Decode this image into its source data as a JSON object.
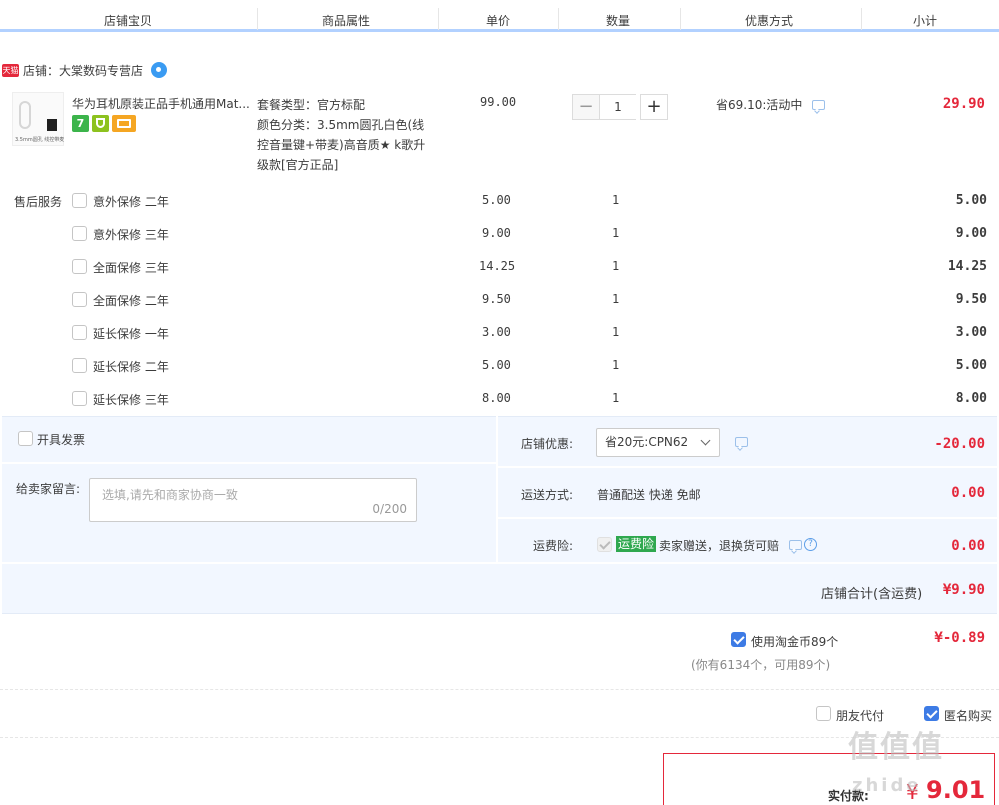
{
  "header": {
    "cols": [
      "店铺宝贝",
      "商品属性",
      "单价",
      "数量",
      "优惠方式",
      "小计"
    ]
  },
  "shop": {
    "badge": "天猫",
    "name": "店铺：大棠数码专营店"
  },
  "item": {
    "thumb_label": "3.5mm圆孔 线控带麦",
    "title": "华为耳机原装正品手机通用Mat...",
    "attr_lines": [
      "套餐类型：官方标配",
      "颜色分类：3.5mm圆孔白色(线",
      "控音量键+带麦)高音质★ k歌升",
      "级款[官方正品]"
    ],
    "price": "99.00",
    "quantity": "1",
    "qty_minus": "−",
    "qty_plus": "+",
    "promo": "省69.10:活动中",
    "subtotal": "29.90",
    "tag7": "7"
  },
  "services": {
    "label": "售后服务",
    "rows": [
      {
        "name": "意外保修 二年",
        "price": "5.00",
        "qty": "1",
        "sub": "5.00"
      },
      {
        "name": "意外保修 三年",
        "price": "9.00",
        "qty": "1",
        "sub": "9.00"
      },
      {
        "name": "全面保修 三年",
        "price": "14.25",
        "qty": "1",
        "sub": "14.25"
      },
      {
        "name": "全面保修 二年",
        "price": "9.50",
        "qty": "1",
        "sub": "9.50"
      },
      {
        "name": "延长保修 一年",
        "price": "3.00",
        "qty": "1",
        "sub": "3.00"
      },
      {
        "name": "延长保修 二年",
        "price": "5.00",
        "qty": "1",
        "sub": "5.00"
      },
      {
        "name": "延长保修 三年",
        "price": "8.00",
        "qty": "1",
        "sub": "8.00"
      }
    ]
  },
  "invoice": {
    "label": "开具发票"
  },
  "message": {
    "label": "给卖家留言:",
    "placeholder": "选填,请先和商家协商一致",
    "count": "0/200"
  },
  "discount": {
    "label": "店铺优惠:",
    "selected": "省20元:CPN62",
    "amount": "-20.00"
  },
  "shipping": {
    "label": "运送方式:",
    "value": "普通配送 快递 免邮",
    "amount": "0.00"
  },
  "insurance": {
    "label": "运费险:",
    "badge": "运费险",
    "desc": "卖家赠送，退换货可赔",
    "help": "?",
    "amount": "0.00"
  },
  "shop_total": {
    "label": "店铺合计(含运费)",
    "amount": "¥9.90"
  },
  "coins": {
    "label": "使用淘金币89个",
    "amount": "¥-0.89",
    "note": "(你有6134个，可用89个)"
  },
  "options": {
    "friend_pay": "朋友代付",
    "anonymous": "匿名购买"
  },
  "pay": {
    "label": "实付款:",
    "currency": "¥",
    "amount": "9.01"
  },
  "watermark": {
    "line1": "值值值",
    "line2": "zhide"
  },
  "colors": {
    "accent": "#e4283b",
    "blue": "#3d7be5",
    "panel": "#f2f7ff",
    "header_border": "#b2d1ff"
  }
}
